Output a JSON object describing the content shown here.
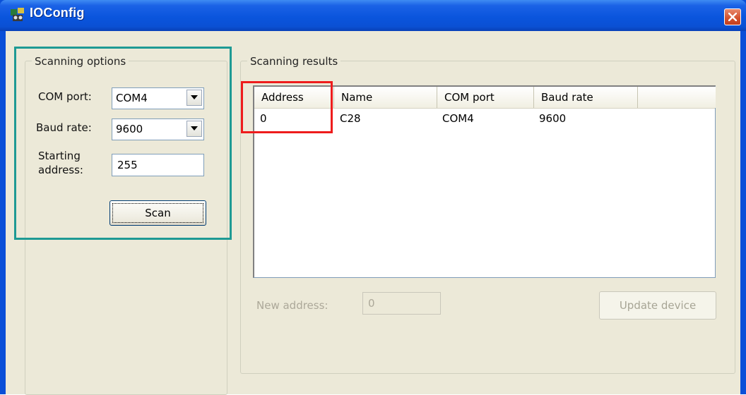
{
  "window": {
    "title": "IOConfig"
  },
  "scanning_options": {
    "legend": "Scanning options",
    "com_port_label": "COM port:",
    "com_port_value": "COM4",
    "baud_rate_label": "Baud rate:",
    "baud_rate_value": "9600",
    "starting_address_label_line1": "Starting",
    "starting_address_label_line2": "address:",
    "starting_address_value": "255",
    "scan_button": "Scan"
  },
  "scanning_results": {
    "legend": "Scanning results",
    "columns": [
      "Address",
      "Name",
      "COM port",
      "Baud rate"
    ],
    "rows": [
      {
        "address": "0",
        "name": "C28",
        "com_port": "COM4",
        "baud_rate": "9600"
      }
    ],
    "new_address_label": "New address:",
    "new_address_value": "0",
    "update_button": "Update device"
  },
  "colors": {
    "highlight_teal": "#1e9a94",
    "highlight_red": "#ee1c1c",
    "titlebar_blue": "#0a55dd",
    "dialog_face": "#ece9d8"
  },
  "icons": [
    "app-icon",
    "close-icon",
    "dropdown-arrow-icon"
  ]
}
